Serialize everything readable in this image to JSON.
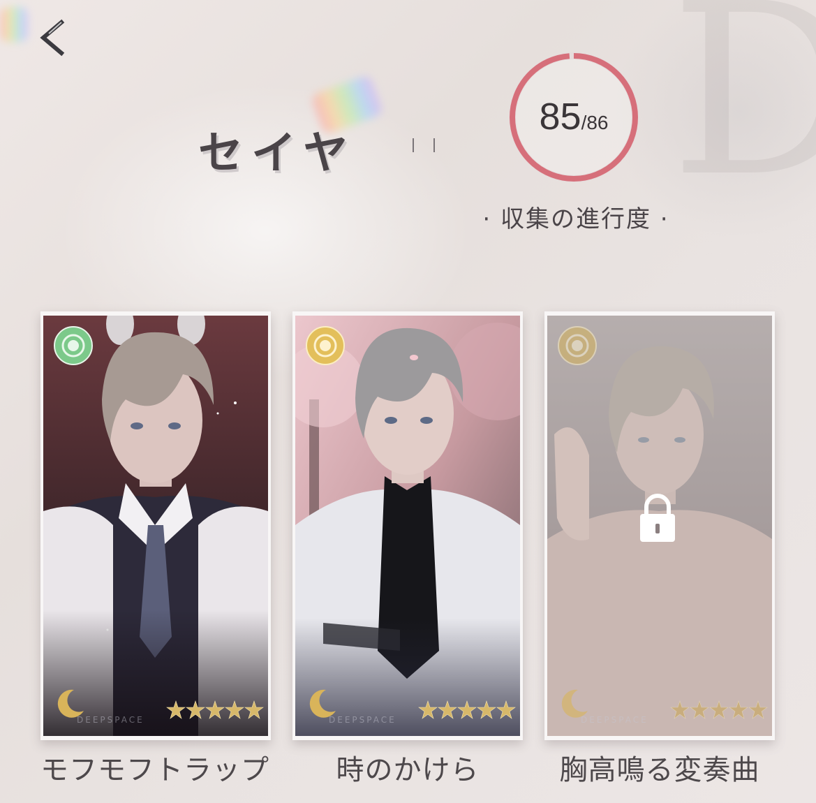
{
  "character": {
    "name": "セイヤ"
  },
  "progress": {
    "current": "85",
    "separator": "/",
    "total": "86",
    "fraction": 0.9884,
    "label": "· 収集の進行度 ·",
    "ring_color": "#d66f7a"
  },
  "cards": [
    {
      "title": "モフモフトラップ",
      "badge_color": "green",
      "stars": 5,
      "locked": false,
      "brand": "DEEPSPACE"
    },
    {
      "title": "時のかけら",
      "badge_color": "gold",
      "stars": 5,
      "locked": false,
      "brand": "DEEPSPACE"
    },
    {
      "title": "胸高鳴る変奏曲",
      "badge_color": "gold",
      "stars": 5,
      "locked": true,
      "brand": "DEEPSPACE"
    }
  ],
  "icons": {
    "back": "chevron-left-icon",
    "lock": "lock-icon",
    "moon": "moon-icon",
    "star": "star-icon",
    "badge": "rarity-badge-icon"
  }
}
